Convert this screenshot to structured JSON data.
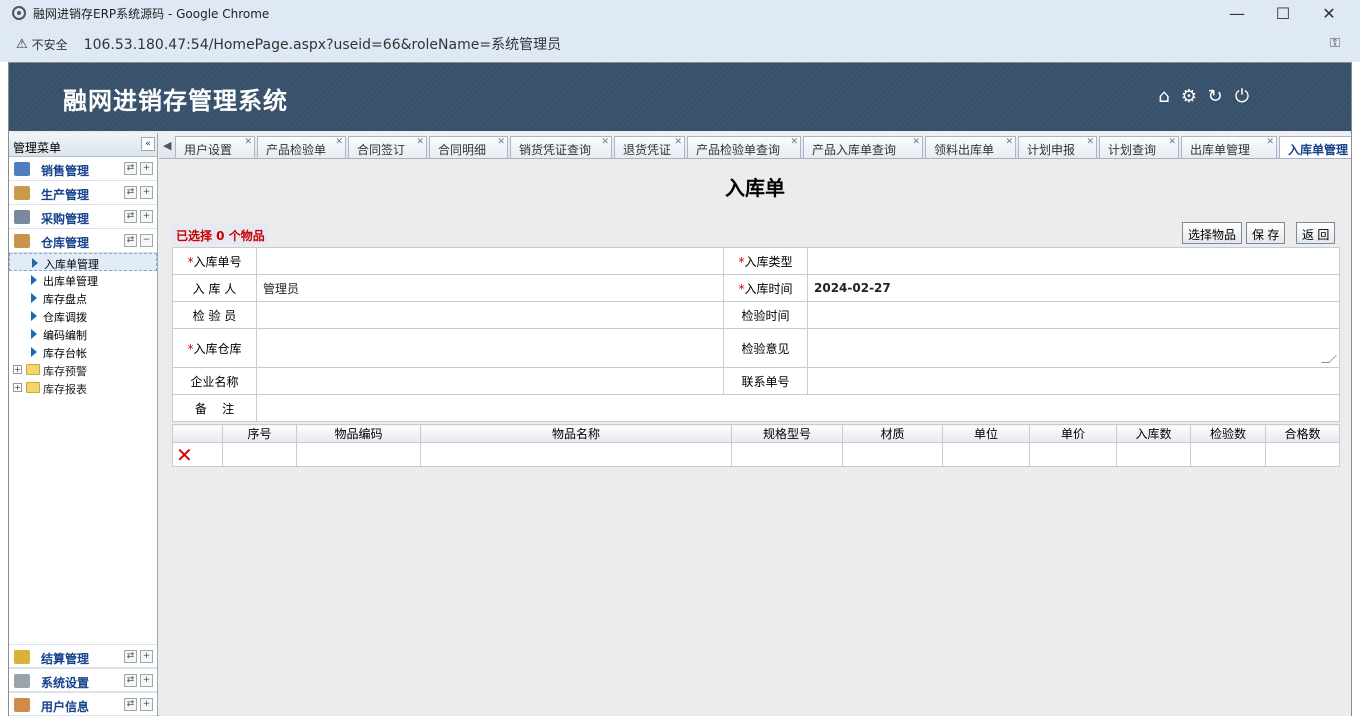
{
  "browser": {
    "window_title": "融网进销存ERP系统源码 - Google Chrome",
    "minimize": "—",
    "maximize": "☐",
    "close": "✕",
    "insecure_label": "不安全",
    "url": "106.53.180.47:54/HomePage.aspx?useid=66&roleName=系统管理员"
  },
  "app": {
    "title": "融网进销存管理系统",
    "header_icons": [
      "home-icon",
      "gear-icon",
      "refresh-icon",
      "power-icon"
    ]
  },
  "sidebar": {
    "header": "管理菜单",
    "groups_top": [
      {
        "label": "销售管理",
        "icon": "store-icon",
        "color": "#4f7fc0"
      },
      {
        "label": "生产管理",
        "icon": "wrench-icon",
        "color": "#c99a4a"
      },
      {
        "label": "采购管理",
        "icon": "truck-icon",
        "color": "#7a8a9c"
      },
      {
        "label": "仓库管理",
        "icon": "box-icon",
        "color": "#c9934a"
      }
    ],
    "warehouse_items": [
      "入库单管理",
      "出库单管理",
      "库存盘点",
      "仓库调拨",
      "编码编制",
      "库存台帐"
    ],
    "folders": [
      "库存预警",
      "库存报表"
    ],
    "groups_bottom": [
      {
        "label": "结算管理",
        "icon": "coins-icon",
        "color": "#d9b23a"
      },
      {
        "label": "系统设置",
        "icon": "cog-icon",
        "color": "#9aa3ad"
      },
      {
        "label": "用户信息",
        "icon": "user-icon",
        "color": "#d28a4a"
      }
    ]
  },
  "tabs": [
    "用户设置",
    "产品检验单",
    "合同签订",
    "合同明细",
    "销货凭证查询",
    "退货凭证",
    "产品检验单查询",
    "产品入库单查询",
    "领料出库单",
    "计划申报",
    "计划查询",
    "出库单管理",
    "入库单管理"
  ],
  "active_tab": "入库单管理",
  "page": {
    "title": "入库单",
    "selected_text": "已选择 0 个物品",
    "buttons": {
      "select_items": "选择物品",
      "save": "保 存",
      "back": "返 回"
    }
  },
  "form": {
    "receipt_no_label": "入库单号",
    "receipt_type_label": "入库类型",
    "receiver_label": "入 库 人",
    "receiver_value": "管理员",
    "receipt_time_label": "入库时间",
    "receipt_time_value": "2024-02-27",
    "inspector_label": "检 验 员",
    "inspection_time_label": "检验时间",
    "warehouse_label": "入库仓库",
    "inspection_opinion_label": "检验意见",
    "company_label": "企业名称",
    "contact_no_label": "联系单号",
    "remark_label": "备    注",
    "required_mark": "*"
  },
  "grid": {
    "columns": [
      "序号",
      "物品编码",
      "物品名称",
      "规格型号",
      "材质",
      "单位",
      "单价",
      "入库数",
      "检验数",
      "合格数"
    ],
    "delete_mark": "✕"
  }
}
